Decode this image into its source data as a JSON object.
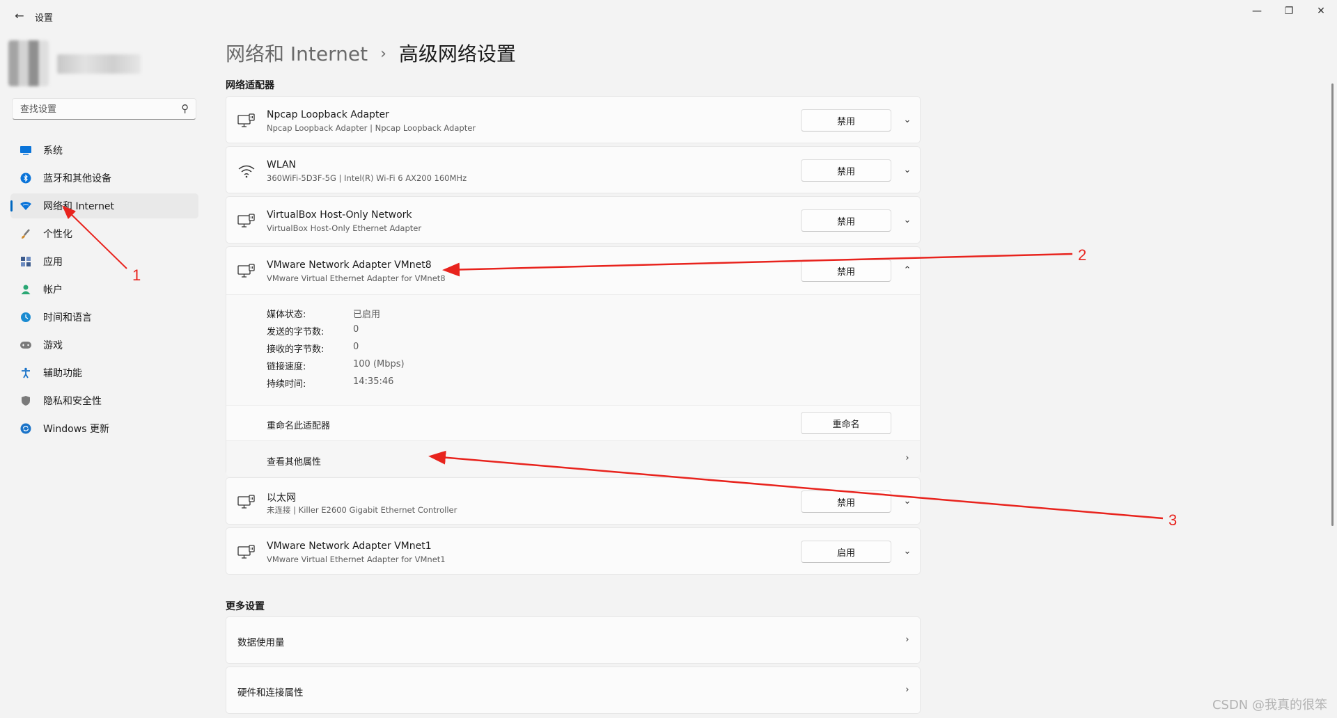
{
  "window": {
    "title": "设置",
    "back_icon": "arrow-left-icon",
    "controls": [
      "—",
      "❐",
      "✕"
    ]
  },
  "search": {
    "placeholder": "查找设置"
  },
  "sidebar": {
    "items": [
      {
        "label": "系统",
        "icon": "monitor-icon",
        "color": "#0a74d9"
      },
      {
        "label": "蓝牙和其他设备",
        "icon": "bluetooth-icon",
        "color": "#0a74d9"
      },
      {
        "label": "网络和 Internet",
        "icon": "wifi-shield-icon",
        "color": "#0a74d9",
        "active": true
      },
      {
        "label": "个性化",
        "icon": "paintbrush-icon",
        "color": "#d08a2b"
      },
      {
        "label": "应用",
        "icon": "apps-icon",
        "color": "#3c5a8c"
      },
      {
        "label": "帐户",
        "icon": "person-icon",
        "color": "#2aa774"
      },
      {
        "label": "时间和语言",
        "icon": "globe-clock-icon",
        "color": "#1a8bd1"
      },
      {
        "label": "游戏",
        "icon": "gamepad-icon",
        "color": "#7a7a7a"
      },
      {
        "label": "辅助功能",
        "icon": "accessibility-icon",
        "color": "#1a73c8"
      },
      {
        "label": "隐私和安全性",
        "icon": "shield-icon",
        "color": "#7a7a7a"
      },
      {
        "label": "Windows 更新",
        "icon": "update-icon",
        "color": "#1a73c8"
      }
    ]
  },
  "breadcrumb": {
    "parent": "网络和 Internet",
    "separator": "›",
    "current": "高级网络设置"
  },
  "adapters_section": {
    "title": "网络适配器",
    "adapters": [
      {
        "name": "Npcap Loopback Adapter",
        "desc": "Npcap Loopback Adapter | Npcap Loopback Adapter",
        "button": "禁用",
        "icon": "network-adapter-icon",
        "chevron": "⌄"
      },
      {
        "name": "WLAN",
        "desc": "360WiFi-5D3F-5G | Intel(R) Wi-Fi 6 AX200 160MHz",
        "button": "禁用",
        "icon": "wifi-icon",
        "chevron": "⌄"
      },
      {
        "name": "VirtualBox Host-Only Network",
        "desc": "VirtualBox Host-Only Ethernet Adapter",
        "button": "禁用",
        "icon": "network-adapter-icon",
        "chevron": "⌄"
      },
      {
        "name": "VMware Network Adapter VMnet8",
        "desc": "VMware Virtual Ethernet Adapter for VMnet8",
        "button": "禁用",
        "icon": "network-adapter-icon",
        "chevron": "⌃"
      },
      {
        "name": "以太网",
        "desc": "未连接 | Killer E2600 Gigabit Ethernet Controller",
        "button": "禁用",
        "icon": "network-adapter-icon",
        "chevron": "⌄"
      },
      {
        "name": "VMware Network Adapter VMnet1",
        "desc": "VMware Virtual Ethernet Adapter for VMnet1",
        "button": "启用",
        "icon": "network-adapter-icon",
        "chevron": "⌄"
      }
    ],
    "expanded": {
      "details": [
        {
          "label": "媒体状态:",
          "value": "已启用"
        },
        {
          "label": "发送的字节数:",
          "value": "0"
        },
        {
          "label": "接收的字节数:",
          "value": "0"
        },
        {
          "label": "链接速度:",
          "value": "100 (Mbps)"
        },
        {
          "label": "持续时间:",
          "value": "14:35:46"
        }
      ],
      "rename_label": "重命名此适配器",
      "rename_button": "重命名",
      "props_label": "查看其他属性",
      "props_chevron": "›"
    }
  },
  "more_section": {
    "title": "更多设置",
    "items": [
      {
        "label": "数据使用量",
        "chevron": "›"
      },
      {
        "label": "硬件和连接属性",
        "chevron": "›"
      }
    ]
  },
  "annotations": {
    "color": "#e8231d",
    "labels": [
      "1",
      "2",
      "3"
    ]
  },
  "watermark": "CSDN @我真的很笨"
}
